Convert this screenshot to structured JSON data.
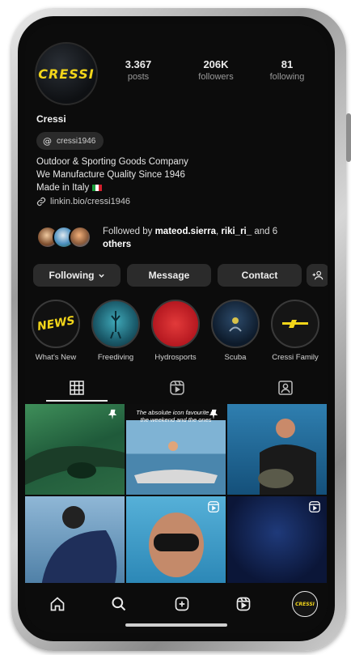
{
  "profile": {
    "avatar_logo_text": "CRESSI",
    "stats": [
      {
        "value": "3.367",
        "label": "posts"
      },
      {
        "value": "206K",
        "label": "followers"
      },
      {
        "value": "81",
        "label": "following"
      }
    ],
    "name": "Cressi",
    "threads_handle": "cressi1946",
    "bio_lines": [
      "Outdoor & Sporting Goods Company",
      "We Manufacture Quality Since 1946",
      "Made in Italy"
    ],
    "link": "linkin.bio/cressi1946",
    "followed_by": {
      "prefix": "Followed by",
      "user1": "mateod.sierra",
      "separator": ",",
      "user2": "riki_ri_",
      "suffix_and": "and 6",
      "others": "others"
    }
  },
  "actions": {
    "following_label": "Following",
    "message_label": "Message",
    "contact_label": "Contact"
  },
  "highlights": [
    {
      "label": "What's New",
      "inner_text": "NEWS"
    },
    {
      "label": "Freediving",
      "inner_text": ""
    },
    {
      "label": "Hydrosports",
      "inner_text": ""
    },
    {
      "label": "Scuba",
      "inner_text": ""
    },
    {
      "label": "Cressi Family",
      "inner_text": ""
    }
  ],
  "tabs": [
    {
      "icon": "grid-icon",
      "active": true
    },
    {
      "icon": "reels-icon",
      "active": false
    },
    {
      "icon": "tagged-icon",
      "active": false
    }
  ],
  "grid_posts": [
    {
      "caption": "",
      "badge": "pin-icon"
    },
    {
      "caption": "The absolute icon favourite of the weekend and the ones",
      "badge": "pin-icon"
    },
    {
      "caption": "",
      "badge": "none"
    },
    {
      "caption": "",
      "badge": "none"
    },
    {
      "caption": "",
      "badge": "reel-icon"
    },
    {
      "caption": "",
      "badge": "reel-icon"
    }
  ],
  "bottom_nav": [
    "home-icon",
    "search-icon",
    "create-icon",
    "reels-icon",
    "profile-avatar"
  ],
  "colors": {
    "brand_yellow": "#f2d51a",
    "background": "#0c0c0c",
    "button": "#2b2b2b"
  }
}
